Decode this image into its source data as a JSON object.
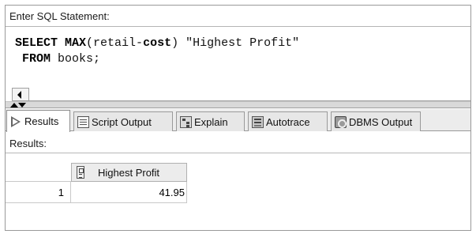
{
  "sql_panel": {
    "label": "Enter SQL Statement:",
    "line1": {
      "kw_select": "SELECT",
      "kw_max": "MAX",
      "part_a": "(retail-",
      "kw_cost": "cost",
      "part_b": ") \"Highest Profit\""
    },
    "line2": {
      "kw_from": "FROM",
      "part_a": " books;"
    }
  },
  "tabs": [
    {
      "label": "Results",
      "icon": "play-icon",
      "active": true
    },
    {
      "label": "Script Output",
      "icon": "script-icon"
    },
    {
      "label": "Explain",
      "icon": "explain-icon"
    },
    {
      "label": "Autotrace",
      "icon": "autotrace-icon"
    },
    {
      "label": "DBMS Output",
      "icon": "dbms-output-icon"
    }
  ],
  "results": {
    "label": "Results:",
    "columns": [
      "Highest Profit"
    ],
    "rows": [
      {
        "num": "1",
        "values": [
          "41.95"
        ]
      }
    ]
  }
}
